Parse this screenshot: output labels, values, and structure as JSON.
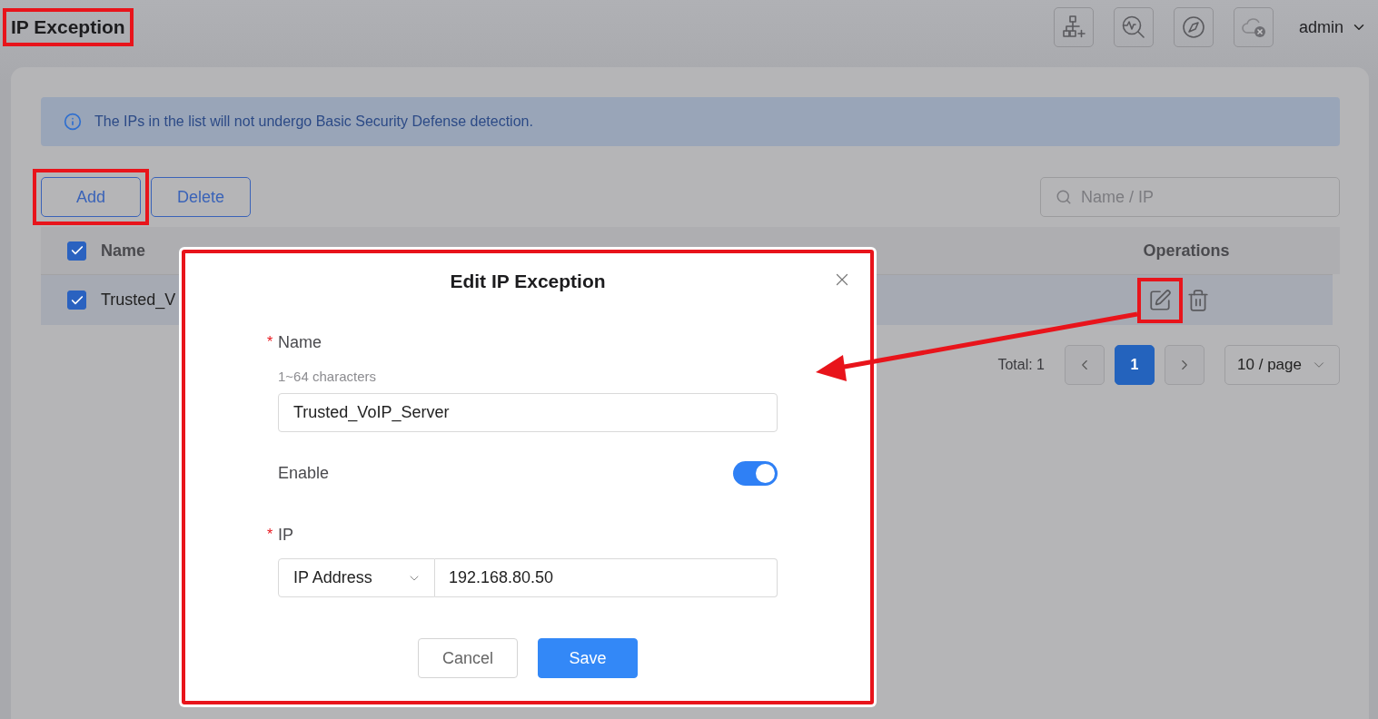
{
  "header": {
    "title": "IP Exception",
    "title_highlighted": true,
    "toolbar": [
      {
        "kind": "topology"
      },
      {
        "kind": "diagnose"
      },
      {
        "kind": "compass"
      },
      {
        "kind": "cloud"
      }
    ],
    "user": "admin"
  },
  "notice": "The IPs in the list will not undergo Basic Security Defense detection.",
  "actions": [
    {
      "label": "Add",
      "highlighted": true
    },
    {
      "label": "Delete",
      "highlighted": false
    }
  ],
  "search": {
    "placeholder": "Name / IP"
  },
  "table": {
    "all_checked": true,
    "columns": [
      "Name",
      "Operations"
    ],
    "rows": [
      {
        "name": "Trusted_V",
        "checked": true,
        "selected": true,
        "edit_highlighted": true
      }
    ]
  },
  "pagination": {
    "total": "Total: 1",
    "pages": [
      {
        "label": "1",
        "selected": true
      }
    ],
    "page_size": "10 / page"
  },
  "dialog": {
    "title": "Edit IP Exception",
    "highlighted": true,
    "fields": [
      {
        "kind": "text",
        "label": "Name",
        "required_mark": "*",
        "hint": "1~64 characters",
        "value": "Trusted_VoIP_Server"
      },
      {
        "kind": "switch",
        "label": "Enable",
        "on": true
      },
      {
        "kind": "ip",
        "label": "IP",
        "required_mark": "*",
        "type": "IP Address",
        "value": "192.168.80.50"
      }
    ],
    "buttons": [
      {
        "label": "Cancel",
        "kind": "secondary"
      },
      {
        "label": "Save",
        "kind": "primary"
      }
    ]
  },
  "callout_arrow": true
}
